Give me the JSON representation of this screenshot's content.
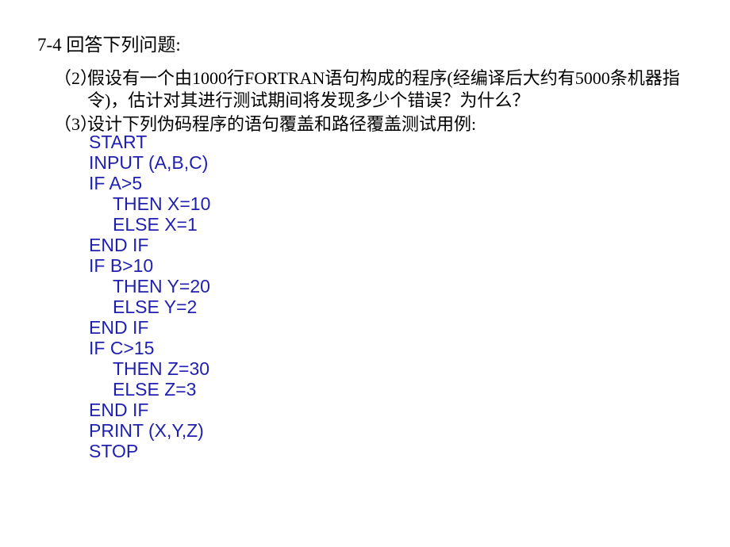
{
  "colors": {
    "background": "#ffffff",
    "body_text": "#000000",
    "code_text": "#1f1fb0"
  },
  "heading": {
    "text": "7-4 回答下列问题:"
  },
  "questions": [
    {
      "marker": "（2）",
      "text": "假设有一个由1000行FORTRAN语句构成的程序(经编译后大约有5000条机器指令)，估计对其进行测试期间将发现多少个错误？为什么？"
    },
    {
      "marker": "（3）",
      "text": "设计下列伪码程序的语句覆盖和路径覆盖测试用例:"
    }
  ],
  "code": {
    "language": "pseudocode",
    "lines": [
      {
        "text": "START",
        "indent": false
      },
      {
        "text": "INPUT (A,B,C)",
        "indent": false
      },
      {
        "text": "IF A>5",
        "indent": false
      },
      {
        "text": "THEN X=10",
        "indent": true
      },
      {
        "text": "ELSE X=1",
        "indent": true
      },
      {
        "text": "END IF",
        "indent": false
      },
      {
        "text": "IF B>10",
        "indent": false
      },
      {
        "text": "THEN Y=20",
        "indent": true
      },
      {
        "text": "ELSE Y=2",
        "indent": true
      },
      {
        "text": "END IF",
        "indent": false
      },
      {
        "text": "IF C>15",
        "indent": false
      },
      {
        "text": "THEN Z=30",
        "indent": true
      },
      {
        "text": "ELSE Z=3",
        "indent": true
      },
      {
        "text": "END IF",
        "indent": false
      },
      {
        "text": "PRINT (X,Y,Z)",
        "indent": false
      },
      {
        "text": "STOP",
        "indent": false
      }
    ]
  }
}
